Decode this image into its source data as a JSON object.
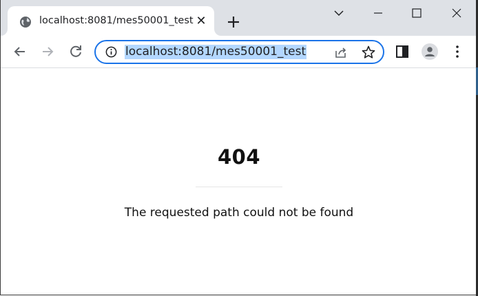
{
  "browser": {
    "tab": {
      "title": "localhost:8081/mes50001_test",
      "favicon": "globe-icon",
      "close": "✕"
    },
    "new_tab": "plus-icon",
    "window_controls": [
      "chevron-down-icon",
      "minimize-icon",
      "maximize-icon",
      "close-icon"
    ],
    "toolbar": {
      "back": "arrow-left-icon",
      "forward": "arrow-right-icon",
      "reload": "reload-icon",
      "side_panel": "side-panel-icon",
      "profile": "profile-icon",
      "menu": "kebab-menu-icon"
    },
    "omnibox": {
      "url": "localhost:8081/mes50001_test",
      "info": "info-icon",
      "share": "share-icon",
      "bookmark": "star-icon"
    },
    "colors": {
      "tabstrip": "#dee1e6",
      "accent": "#1a73e8",
      "selection": "#b3d7ff"
    }
  },
  "page": {
    "status_code": "404",
    "message": "The requested path could not be found"
  }
}
